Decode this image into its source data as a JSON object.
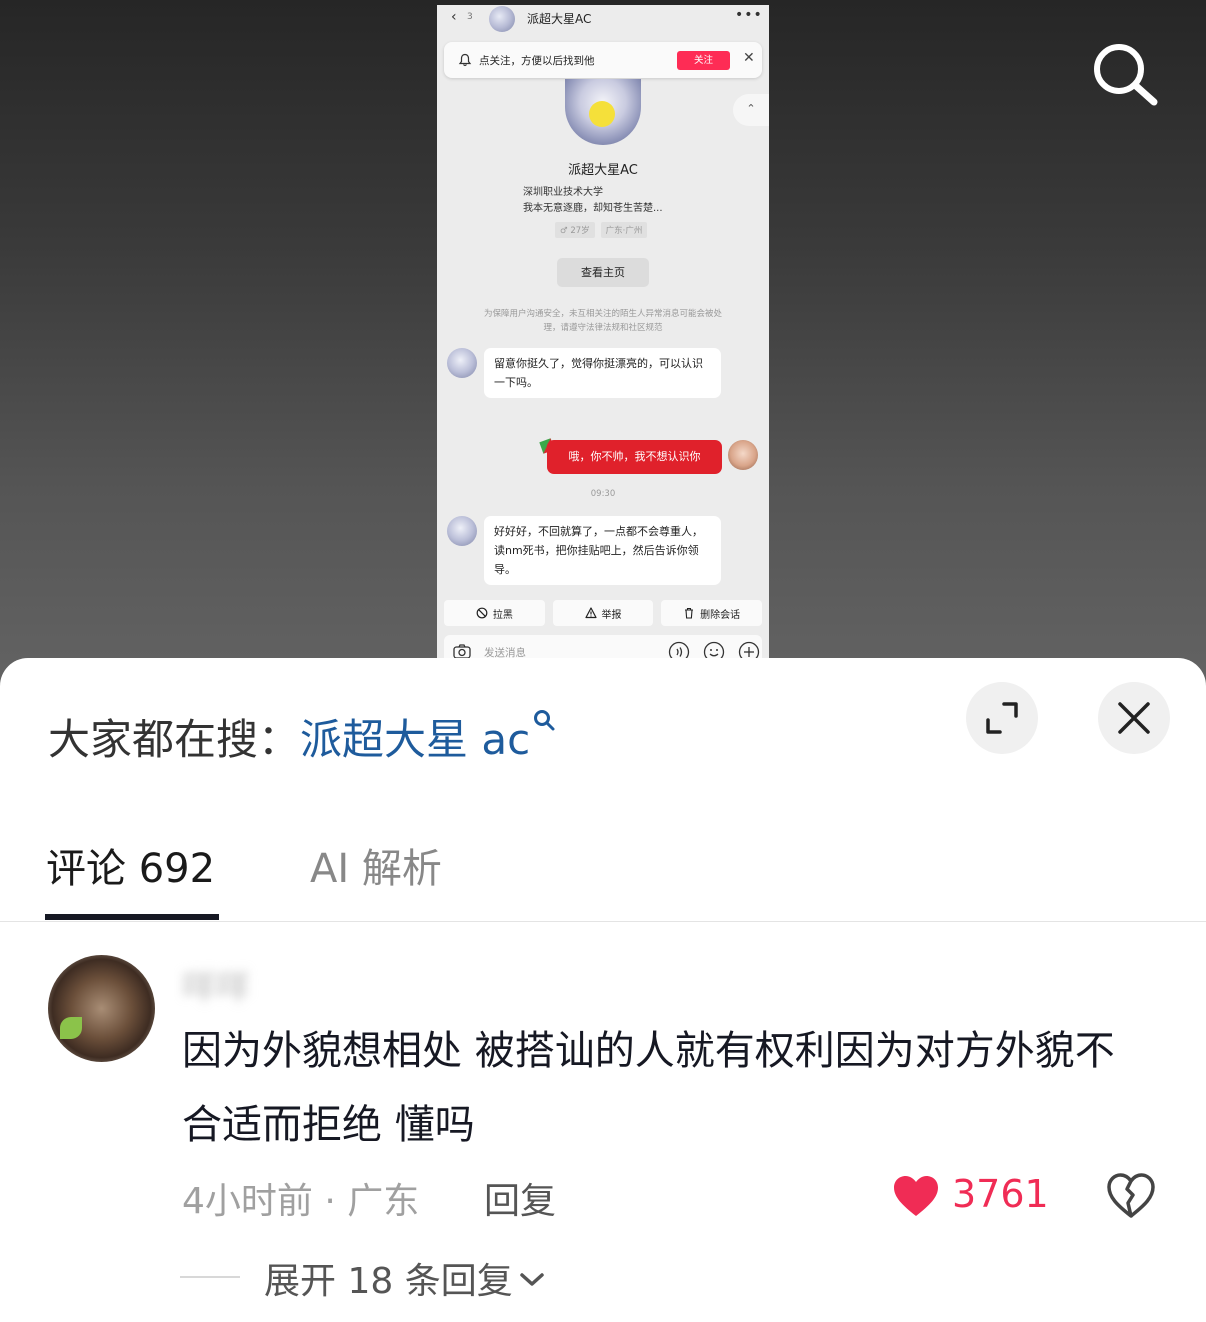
{
  "phone": {
    "header": {
      "back_icon": "back-chevron-icon",
      "unread": "3",
      "name": "派超大星AC",
      "more": "•••"
    },
    "banner": {
      "text": "点关注，方便以后找到他",
      "follow": "关注",
      "close": "✕"
    },
    "collapse": "⌃",
    "profile": {
      "name": "派超大星AC",
      "school": "深圳职业技术大学",
      "bio": "我本无意逐鹿，却知苍生苦楚...",
      "tags": [
        "♂ 27岁",
        "广东·广州"
      ],
      "home_button": "查看主页"
    },
    "notice": "为保障用户沟通安全，未互相关注的陌生人异常消息可能会被处理，请遵守法律法规和社区规范",
    "messages": [
      {
        "from": "other",
        "text": "留意你挺久了，觉得你挺漂亮的，可以认识一下吗。"
      },
      {
        "from": "me",
        "text": "哦，你不帅，我不想认识你"
      },
      {
        "from": "time",
        "text": "09:30"
      },
      {
        "from": "other",
        "text": "好好好，不回就算了，一点都不会尊重人，读nm死书，把你挂贴吧上，然后告诉你领导。"
      }
    ],
    "actions": [
      {
        "icon": "block-icon",
        "label": "拉黑"
      },
      {
        "icon": "warning-icon",
        "label": "举报"
      },
      {
        "icon": "trash-icon",
        "label": "删除会话"
      }
    ],
    "input": {
      "placeholder": "发送消息"
    }
  },
  "sheet": {
    "search_prefix": "大家都在搜：",
    "search_keyword": "派超大星 ac",
    "tabs": [
      {
        "label": "评论 692",
        "active": true
      },
      {
        "label": "AI 解析",
        "active": false
      }
    ],
    "comment": {
      "user": "咩咩",
      "text": "因为外貌想相处 被搭讪的人就有权利因为对方外貌不合适而拒绝 懂吗",
      "meta": "4小时前 · 广东",
      "reply": "回复",
      "likes": "3761",
      "expand": "展开 18 条回复"
    }
  },
  "colors": {
    "accent": "#fe2c55",
    "link": "#1e5b9c",
    "like": "#f02c55"
  }
}
